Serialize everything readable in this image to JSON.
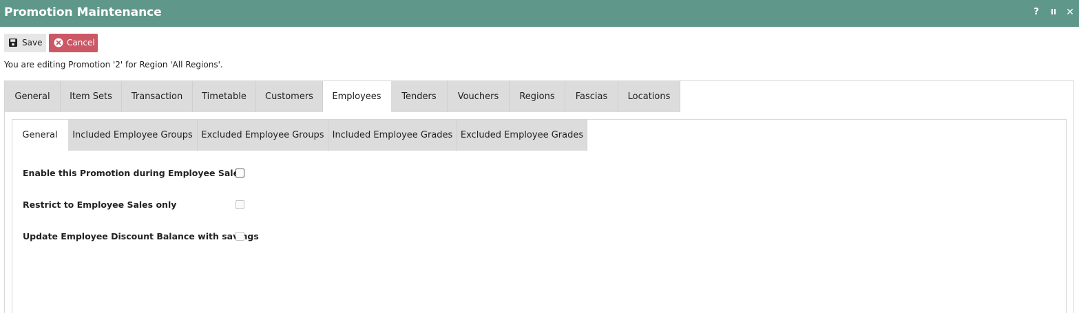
{
  "window": {
    "title": "Promotion Maintenance",
    "help_label": "?",
    "pause_label": "II",
    "close_label": "✕"
  },
  "toolbar": {
    "save_label": "Save",
    "cancel_label": "Cancel"
  },
  "info_text": "You are editing Promotion '2' for Region 'All Regions'.",
  "main_tabs": [
    {
      "label": "General"
    },
    {
      "label": "Item Sets"
    },
    {
      "label": "Transaction"
    },
    {
      "label": "Timetable"
    },
    {
      "label": "Customers"
    },
    {
      "label": "Employees",
      "active": true
    },
    {
      "label": "Tenders"
    },
    {
      "label": "Vouchers"
    },
    {
      "label": "Regions"
    },
    {
      "label": "Fascias"
    },
    {
      "label": "Locations"
    }
  ],
  "sub_tabs": [
    {
      "label": "General",
      "active": true
    },
    {
      "label": "Included Employee Groups"
    },
    {
      "label": "Excluded Employee Groups"
    },
    {
      "label": "Included Employee Grades"
    },
    {
      "label": "Excluded Employee Grades"
    }
  ],
  "fields": [
    {
      "label": "Enable this Promotion during Employee Sales",
      "checked": false,
      "enabled": true
    },
    {
      "label": "Restrict to Employee Sales only",
      "checked": false,
      "enabled": false
    },
    {
      "label": "Update Employee Discount Balance with savings",
      "checked": false,
      "enabled": false
    }
  ],
  "colors": {
    "titlebar": "#5f988a",
    "cancel": "#cc5866",
    "tab_inactive": "#dcdcdc"
  }
}
